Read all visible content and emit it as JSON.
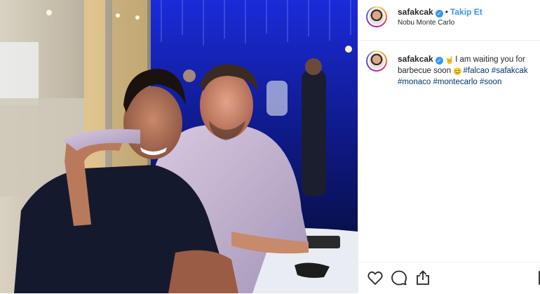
{
  "post": {
    "username": "safakcak",
    "verified_mark": "✓",
    "separator": "•",
    "follow_label": "Takip Et",
    "location": "Nobu Monte Carlo"
  },
  "caption": {
    "username": "safakcak",
    "text_before": "I am waiting you for barbecue soon",
    "emoji_start": "🤘",
    "emoji_end": "😊",
    "hashtags": [
      "#falcao",
      "#safakcak",
      "#monaco",
      "#montecarlo",
      "#soon"
    ]
  },
  "actions": {
    "icons": [
      "heart-icon",
      "comment-icon",
      "share-icon",
      "save-icon"
    ]
  },
  "colors": {
    "link_blue": "#3897f0",
    "hashtag": "#003569",
    "border": "#efefef",
    "text": "#262626"
  }
}
